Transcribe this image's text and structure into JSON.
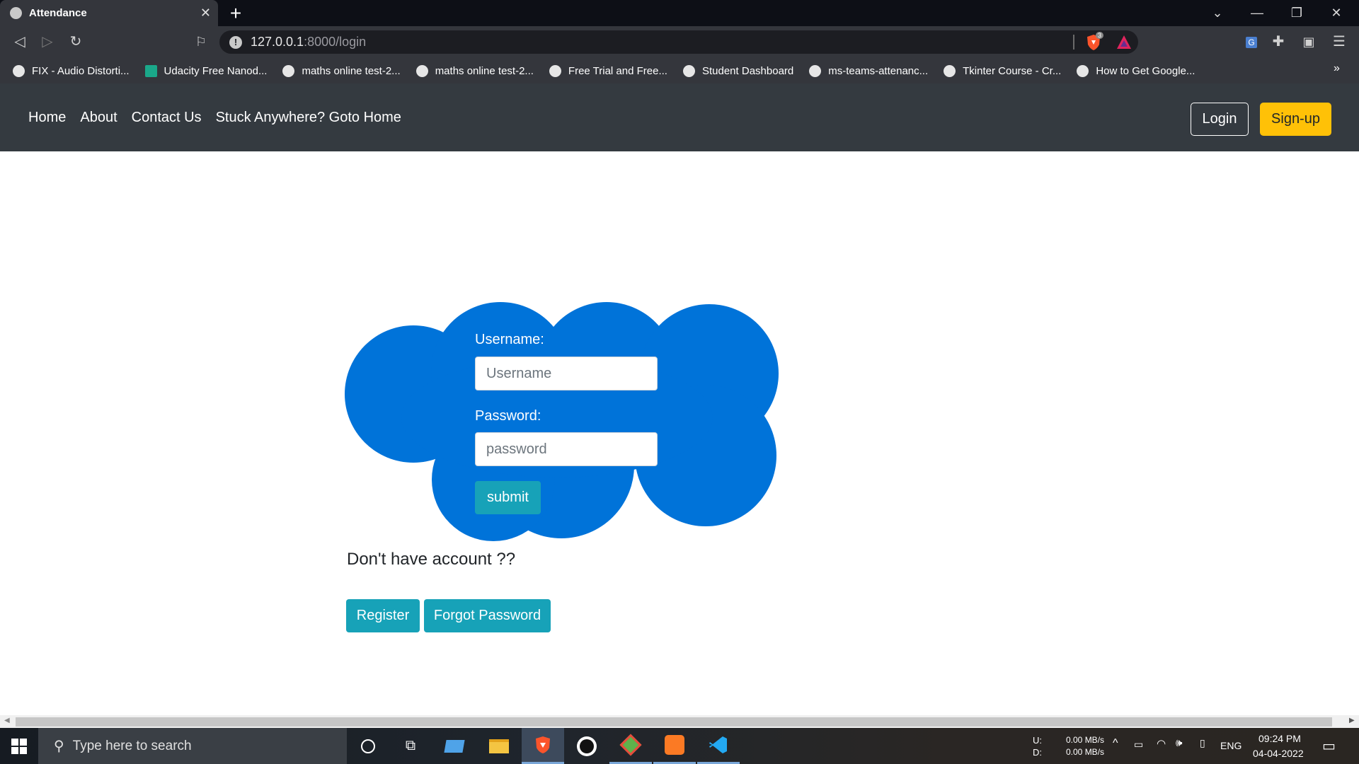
{
  "browser": {
    "tab_title": "Attendance",
    "url_host": "127.0.0.1",
    "url_path": ":8000/login",
    "brave_badge": "3",
    "bookmarks": [
      "FIX - Audio Distorti...",
      "Udacity Free Nanod...",
      "maths online test-2...",
      "maths online test-2...",
      "Free Trial and Free...",
      "Student Dashboard",
      "ms-teams-attenanc...",
      "Tkinter Course - Cr...",
      "How to Get Google..."
    ]
  },
  "nav": {
    "links": [
      "Home",
      "About",
      "Contact Us",
      "Stuck Anywhere? Goto Home"
    ],
    "login": "Login",
    "signup": "Sign-up"
  },
  "form": {
    "username_label": "Username:",
    "username_placeholder": "Username",
    "password_label": "Password:",
    "password_placeholder": "password",
    "submit": "submit"
  },
  "account": {
    "question": "Don't have account ??",
    "register": "Register",
    "forgot": "Forgot Password"
  },
  "taskbar": {
    "search_placeholder": "Type here to search",
    "net_up_label": "U:",
    "net_down_label": "D:",
    "net_up": "0.00 MB/s",
    "net_down": "0.00 MB/s",
    "lang": "ENG",
    "time": "09:24 PM",
    "date": "04-04-2022"
  },
  "colors": {
    "cloud": "#0073d9",
    "info_button": "#17a2b8",
    "warning_button": "#ffc107",
    "navbar": "#343a40"
  }
}
